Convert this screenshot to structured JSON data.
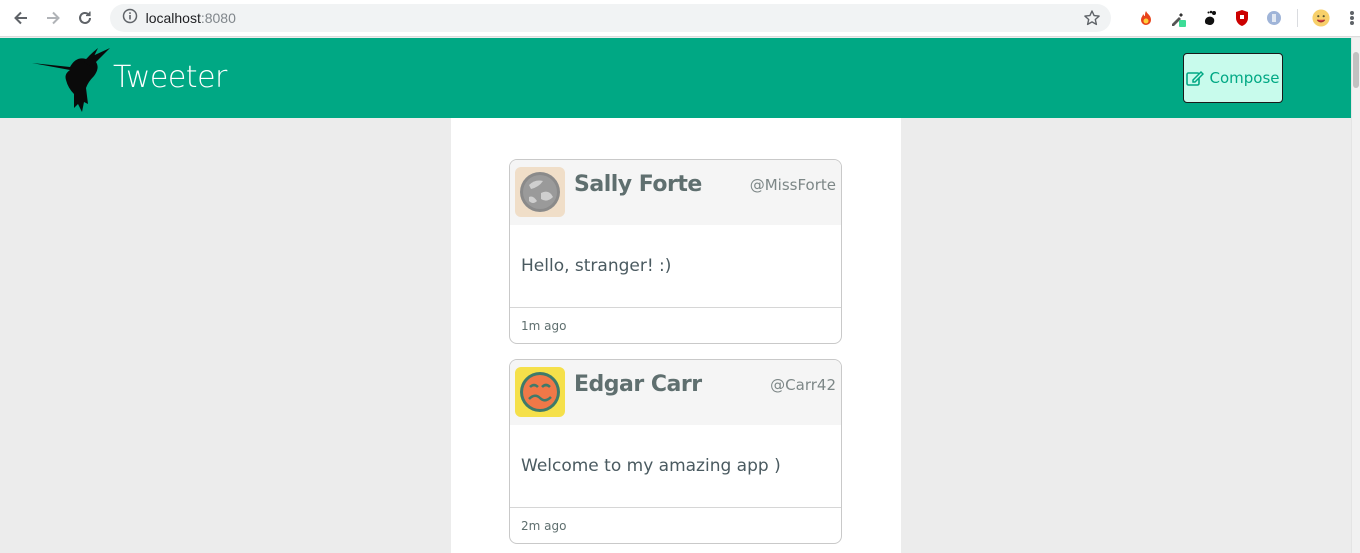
{
  "browser": {
    "url_host": "localhost",
    "url_port": ":8080",
    "icons": [
      "back-arrow-icon",
      "forward-arrow-icon",
      "reload-icon",
      "info-icon",
      "bookmark-star-icon",
      "menu-dots-icon"
    ]
  },
  "header": {
    "brand": "Tweeter",
    "compose_label": "Compose",
    "background": "#00a884"
  },
  "tweets": [
    {
      "author": "Sally Forte",
      "handle": "@MissForte",
      "text": "Hello, stranger! :)",
      "time": "1m ago",
      "avatar_bg": "#f0dec8"
    },
    {
      "author": "Edgar Carr",
      "handle": "@Carr42",
      "text": "Welcome to my amazing app )",
      "time": "2m ago",
      "avatar_bg": "#f5e04a"
    }
  ]
}
